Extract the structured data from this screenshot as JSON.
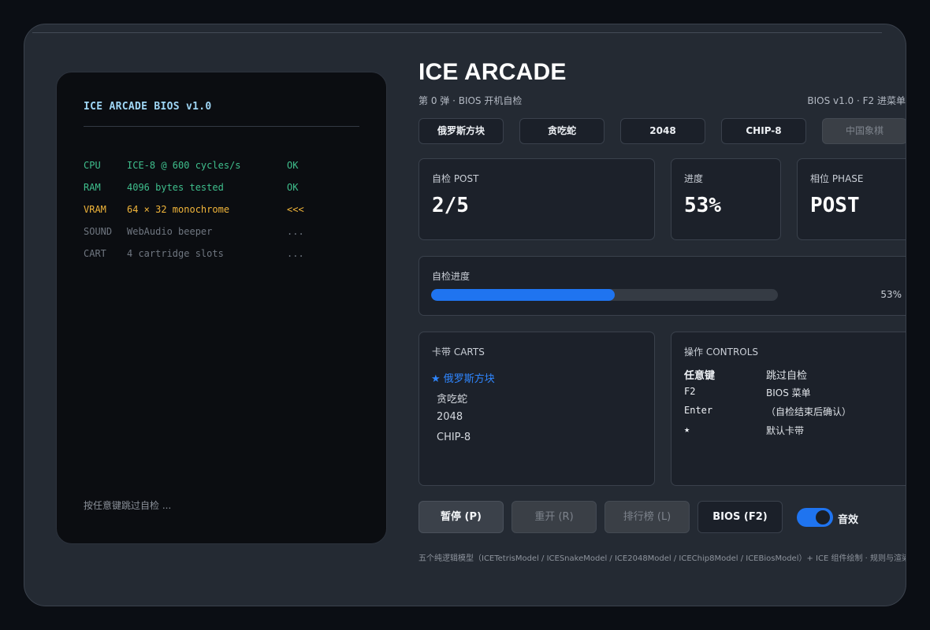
{
  "terminal": {
    "title": "ICE ARCADE BIOS v1.0",
    "rows": [
      {
        "device": "CPU",
        "detail": "ICE-8 @ 600 cycles/s",
        "status": "OK"
      },
      {
        "device": "RAM",
        "detail": "4096 bytes tested",
        "status": "OK"
      },
      {
        "device": "VRAM",
        "detail": "64 × 32 monochrome",
        "status": "<<<"
      },
      {
        "device": "SOUND",
        "detail": "WebAudio beeper",
        "status": "..."
      },
      {
        "device": "CART",
        "detail": "4 cartridge slots",
        "status": "..."
      }
    ],
    "hint": "按任意键跳过自检 ..."
  },
  "header": {
    "title": "ICE ARCADE",
    "subtitle": "第 0 弹 · BIOS 开机自检",
    "version": "BIOS v1.0 · F2 进菜单"
  },
  "tabs": [
    "俄罗斯方块",
    "贪吃蛇",
    "2048",
    "CHIP-8",
    "中国象棋"
  ],
  "stats": {
    "post": {
      "label": "自检 POST",
      "value": "2/5"
    },
    "progress": {
      "label": "进度",
      "value": "53%"
    },
    "phase": {
      "label": "相位 PHASE",
      "value": "POST"
    }
  },
  "selftest": {
    "label": "自检进度",
    "percent_text": "53%",
    "fraction": 0.53
  },
  "carts": {
    "label": "卡带 CARTS",
    "items": [
      "★ 俄罗斯方块",
      "贪吃蛇",
      "2048",
      "CHIP-8"
    ]
  },
  "controls": {
    "label": "操作 CONTROLS",
    "rows": [
      {
        "key": "任意键",
        "action": "跳过自检"
      },
      {
        "key": "F2",
        "action": "BIOS 菜单"
      },
      {
        "key": "Enter",
        "action": "（自检结束后确认）"
      },
      {
        "key": "★",
        "action": "默认卡带"
      }
    ]
  },
  "buttons": {
    "pause": "暂停 (P)",
    "restart": "重开 (R)",
    "leaderboard": "排行榜 (L)",
    "bios": "BIOS (F2)"
  },
  "sound": {
    "label": "音效",
    "on": true
  },
  "footer": "五个纯逻辑模型（ICETetrisModel / ICESnakeModel / ICE2048Model / ICEChip8Model / ICEBiosModel）+ ICE 组件绘制 · 规则与渲染完全解耦",
  "colors": {
    "accent": "#1f74f0",
    "ok": "#3fbf8d",
    "warn": "#f1b53a",
    "title_cyan": "#9fd6f5"
  }
}
